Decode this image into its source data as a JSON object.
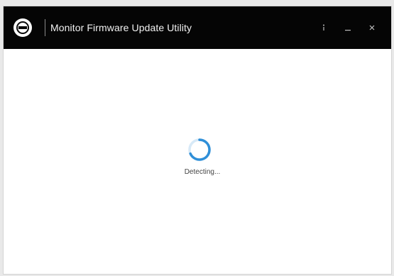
{
  "window": {
    "title": "Monitor Firmware Update Utility"
  },
  "logo": {
    "icon": "dell-logo-icon"
  },
  "title_controls": {
    "info_icon": "info-icon",
    "minimize_icon": "minimize-icon",
    "close_icon": "close-icon"
  },
  "content": {
    "status_text": "Detecting...",
    "spinner_icon": "loading-spinner-icon"
  },
  "colors": {
    "titlebar_bg": "#050505",
    "content_bg": "#ffffff",
    "spinner_accent": "#2f8fd8"
  }
}
